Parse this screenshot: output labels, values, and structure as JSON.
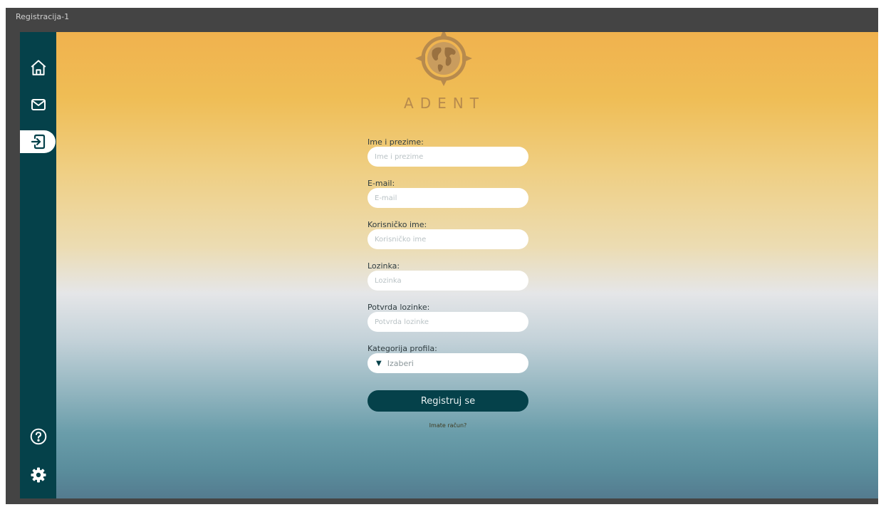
{
  "window": {
    "title": "Registracija-1"
  },
  "brand": {
    "name": "ADENT"
  },
  "sidebar": {
    "items": [
      {
        "name": "home",
        "icon": "home-icon"
      },
      {
        "name": "messages",
        "icon": "mail-icon"
      },
      {
        "name": "register",
        "icon": "sign-in-icon",
        "active": true
      },
      {
        "name": "help",
        "icon": "help-icon"
      },
      {
        "name": "settings",
        "icon": "gear-icon"
      }
    ]
  },
  "form": {
    "full_name": {
      "label": "Ime i prezime:",
      "placeholder": "Ime i prezime"
    },
    "email": {
      "label": "E-mail:",
      "placeholder": "E-mail"
    },
    "username": {
      "label": "Korisničko ime:",
      "placeholder": "Korisničko ime"
    },
    "password": {
      "label": "Lozinka:",
      "placeholder": "Lozinka"
    },
    "password_confirm": {
      "label": "Potvrda lozinke:",
      "placeholder": "Potvrda lozinke"
    },
    "category": {
      "label": "Kategorija profila:",
      "selected": "Izaberi"
    },
    "submit_label": "Registruj se",
    "login_link": "Imate račun?"
  },
  "colors": {
    "sidebar": "#05414a",
    "frame": "#444444",
    "button": "#05414a",
    "brand": "#b78a4d"
  }
}
